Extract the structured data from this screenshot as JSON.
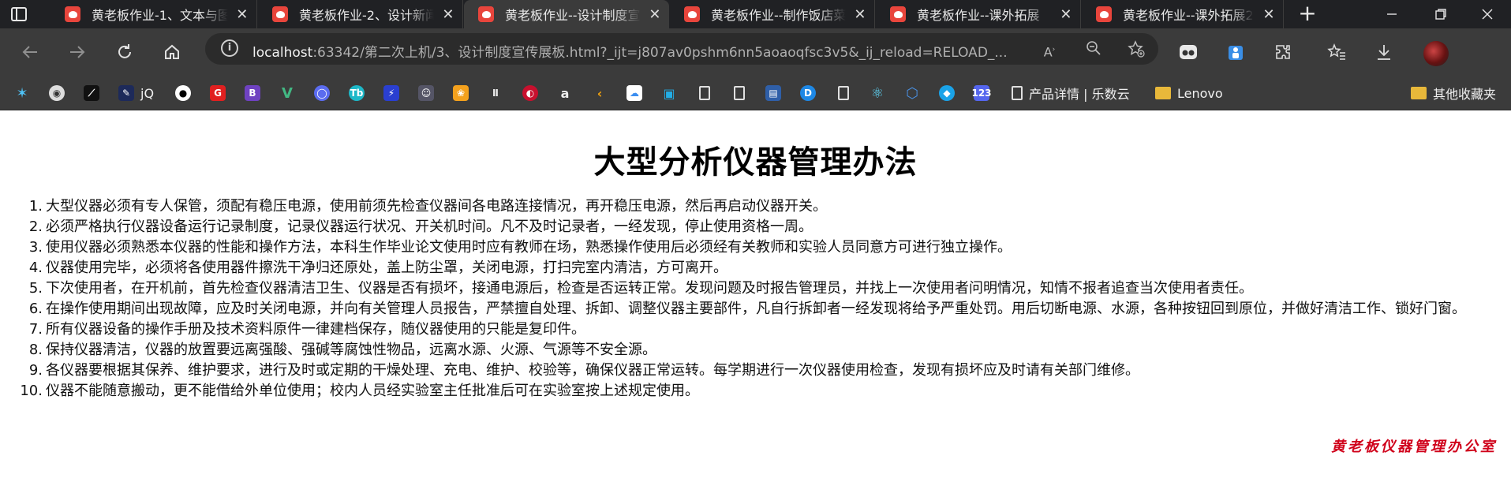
{
  "browser": {
    "tabs": [
      {
        "title": "黄老板作业-1、文本与图",
        "active": false
      },
      {
        "title": "黄老板作业-2、设计新闻",
        "active": false
      },
      {
        "title": "黄老板作业--设计制度宣",
        "active": true
      },
      {
        "title": "黄老板作业--制作饭店菜",
        "active": false
      },
      {
        "title": "黄老板作业--课外拓展",
        "active": false
      },
      {
        "title": "黄老板作业--课外拓展2",
        "active": false
      }
    ],
    "url_host": "localhost",
    "url_rest": ":63342/第二次上机/3、设计制度宣传展板.html?_ijt=j807av0pshm6nn5aoaoqfsc3v5&_ij_reload=RELOAD_...",
    "bookmarks": {
      "jq_label": "jQ",
      "product_label": "产品详情 | 乐数云",
      "lenovo_label": "Lenovo",
      "other_label": "其他收藏夹"
    }
  },
  "page": {
    "title": "大型分析仪器管理办法",
    "rules": [
      "大型仪器必须有专人保管，须配有稳压电源，使用前须先检查仪器间各电路连接情况，再开稳压电源，然后再启动仪器开关。",
      "必须严格执行仪器设备运行记录制度，记录仪器运行状况、开关机时间。凡不及时记录者，一经发现，停止使用资格一周。",
      "使用仪器必须熟悉本仪器的性能和操作方法，本科生作毕业论文使用时应有教师在场，熟悉操作使用后必须经有关教师和实验人员同意方可进行独立操作。",
      "仪器使用完毕，必须将各使用器件擦洗干净归还原处，盖上防尘罩，关闭电源，打扫完室内清洁，方可离开。",
      "下次使用者，在开机前，首先检查仪器清洁卫生、仪器是否有损坏，接通电源后，检查是否运转正常。发现问题及时报告管理员，并找上一次使用者问明情况，知情不报者追查当次使用者责任。",
      "在操作使用期间出现故障，应及时关闭电源，并向有关管理人员报告，严禁擅自处理、拆卸、调整仪器主要部件，凡自行拆卸者一经发现将给予严重处罚。用后切断电源、水源，各种按钮回到原位，并做好清洁工作、锁好门窗。",
      "所有仪器设备的操作手册及技术资料原件一律建档保存，随仪器使用的只能是复印件。",
      "保持仪器清洁，仪器的放置要远离强酸、强碱等腐蚀性物品，远离水源、火源、气源等不安全源。",
      "各仪器要根据其保养、维护要求，进行及时或定期的干燥处理、充电、维护、校验等，确保仪器正常运转。每学期进行一次仪器使用检查，发现有损坏应及时请有关部门维修。",
      "仪器不能随意搬动，更不能借给外单位使用；校内人员经实验室主任批准后可在实验室按上述规定使用。"
    ],
    "signature": "黄老板仪器管理办公室"
  },
  "colors": {
    "signature": "#d0021b",
    "tab_favicon": "#e8453c",
    "chrome_dark": "#202124",
    "toolbar": "#3b3b3b"
  },
  "icons": [
    "sidebar-icon",
    "back-icon",
    "forward-icon",
    "refresh-icon",
    "home-icon",
    "info-icon",
    "read-aloud-icon",
    "zoom-out-icon",
    "add-favorite-icon",
    "extensions-icon",
    "favorites-icon",
    "downloads-icon",
    "profile-avatar"
  ]
}
